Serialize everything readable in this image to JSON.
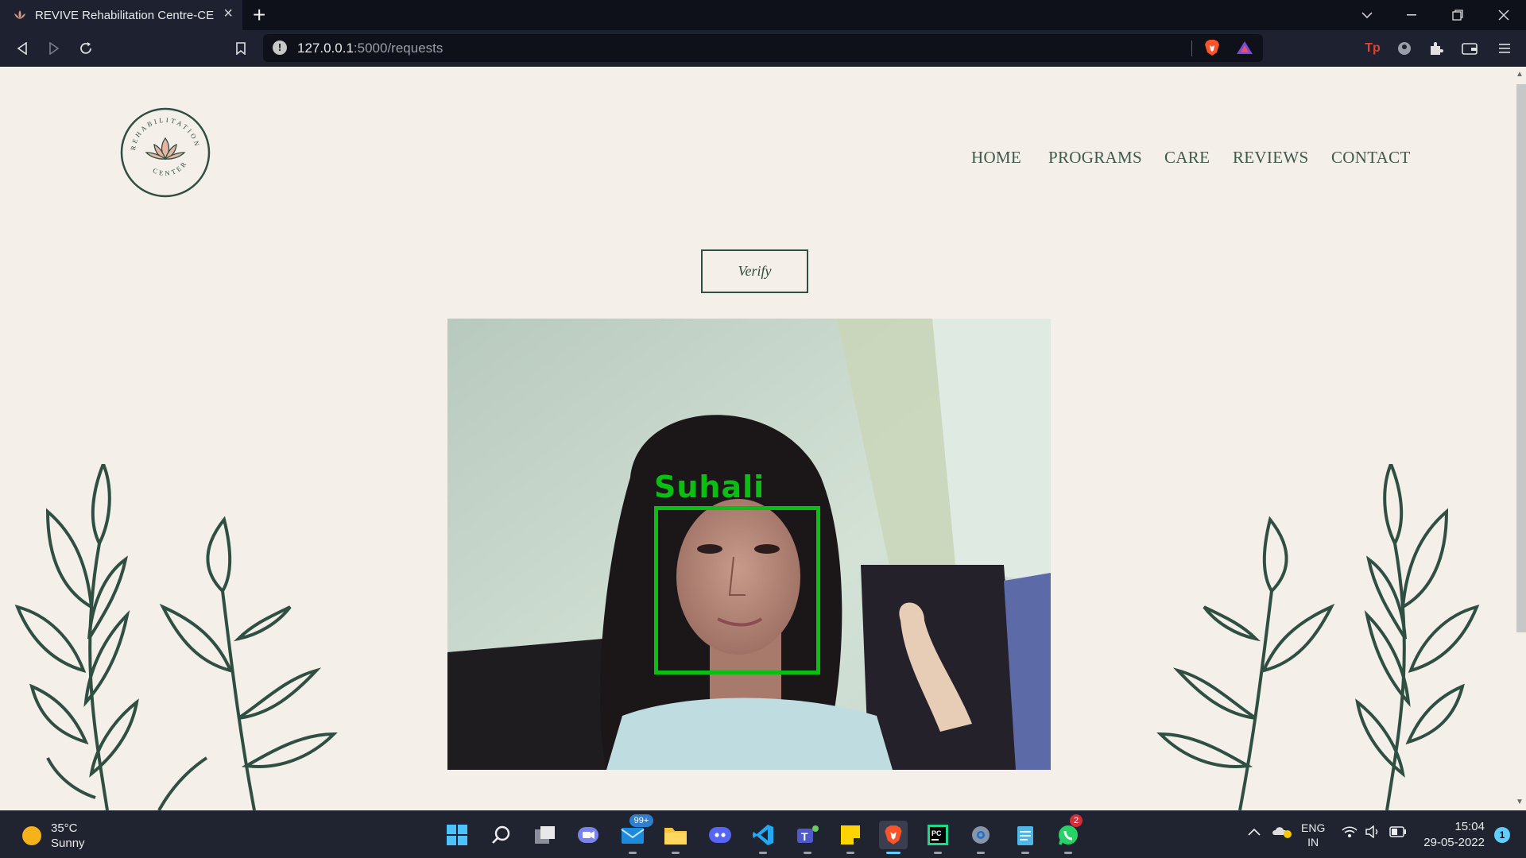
{
  "browser": {
    "tab_title": "REVIVE Rehabilitation Centre-CEL",
    "url_host": "127.0.0.1",
    "url_path": ":5000/requests"
  },
  "site": {
    "logo_text_top": "REHABILITATION",
    "logo_text_bottom": "CENTER",
    "nav": [
      "HOME",
      "PROGRAMS",
      "CARE",
      "REVIEWS",
      "CONTACT"
    ],
    "verify_label": "Verify",
    "face_label": "Suhali"
  },
  "taskbar": {
    "temperature": "35°C",
    "condition": "Sunny",
    "mail_badge": "99+",
    "whatsapp_badge": "2",
    "lang_top": "ENG",
    "lang_bottom": "IN",
    "time": "15:04",
    "date": "29-05-2022",
    "notification_count": "1"
  },
  "colors": {
    "page_bg": "#f4efe9",
    "brand_green": "#2f4f42",
    "face_box": "#0bbf12"
  }
}
